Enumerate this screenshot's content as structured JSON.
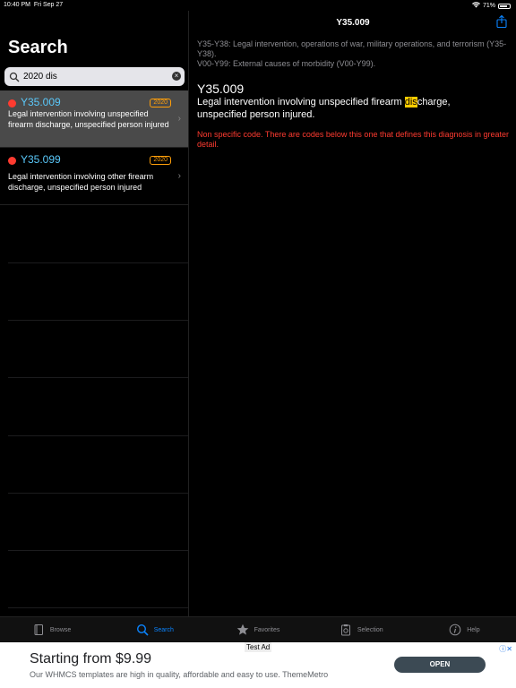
{
  "status": {
    "time": "10:40 PM",
    "date": "Fri Sep 27",
    "battery": "71%"
  },
  "search": {
    "title": "Search",
    "query": "2020 dis",
    "results": [
      {
        "code": "Y35.009",
        "year": "2020",
        "desc": "Legal intervention involving unspecified firearm discharge, unspecified person injured"
      },
      {
        "code": "Y35.099",
        "year": "2020",
        "desc": "Legal intervention involving other firearm discharge, unspecified person injured"
      }
    ]
  },
  "detail": {
    "nav_title": "Y35.009",
    "hierarchy_1": "Y35-Y38: Legal intervention, operations of war, military operations, and terrorism (Y35-Y38).",
    "hierarchy_2": "V00-Y99: External causes of morbidity (V00-Y99).",
    "code": "Y35.009",
    "desc_pre": "Legal intervention involving unspecified firearm ",
    "desc_hl": "dis",
    "desc_post": "charge, unspecified person injured.",
    "note": "Non specific code. There are codes below this one that defines this diagnosis in greater detail."
  },
  "tabs": [
    {
      "label": "Browse",
      "icon": "book-icon"
    },
    {
      "label": "Search",
      "icon": "search-icon"
    },
    {
      "label": "Favorites",
      "icon": "star-icon"
    },
    {
      "label": "Selection",
      "icon": "clipboard-icon"
    },
    {
      "label": "Help",
      "icon": "info-icon"
    }
  ],
  "ad": {
    "label": "Test Ad",
    "headline": "Starting from $9.99",
    "sub": "Our WHMCS templates are high in quality, affordable and easy to use. ThemeMetro",
    "cta": "OPEN"
  },
  "colors": {
    "accent": "#0a84ff",
    "code": "#5ac8fa",
    "error": "#ff3b30",
    "badge": "#ff9f0a",
    "highlight": "#ffcc00"
  }
}
